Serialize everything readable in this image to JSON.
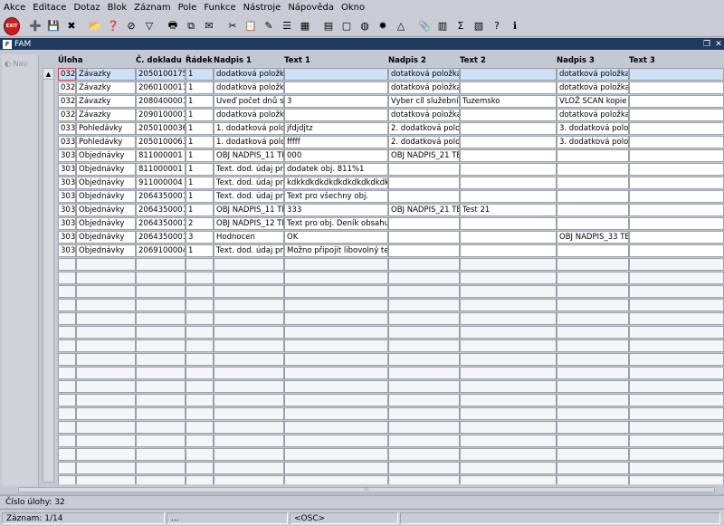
{
  "menu": [
    "Akce",
    "Editace",
    "Dotaz",
    "Blok",
    "Záznam",
    "Pole",
    "Funkce",
    "Nástroje",
    "Nápověda",
    "Okno"
  ],
  "toolbar": {
    "exit_label": "EXIT",
    "icons": [
      "add-record-icon",
      "save-icon",
      "delete-record-icon",
      "folder-open-icon",
      "query-icon",
      "clear-query-icon",
      "filter-icon",
      "print-icon",
      "copy-icon",
      "mail-icon",
      "cut-icon",
      "paste-icon",
      "edit-icon",
      "list-icon",
      "grid-icon",
      "calculator-icon",
      "document-icon",
      "globe-icon",
      "settings-icon",
      "triangle-icon",
      "attach-icon",
      "report-icon",
      "sum-icon",
      "chart-icon",
      "help-icon",
      "info-icon"
    ],
    "sum_glyph": "Σ"
  },
  "window": {
    "title": "FAM",
    "logo": "F"
  },
  "nav": {
    "label": "Nav"
  },
  "columns": [
    "Úloha",
    "Č. dokladu",
    "Řádek",
    "Nadpis 1",
    "Text 1",
    "Nadpis 2",
    "Text 2",
    "Nadpis 3",
    "Text 3"
  ],
  "rows": [
    [
      "032",
      "Závazky",
      "2050100175",
      "1",
      "dodatková položka",
      "",
      "dotatková položka č",
      "",
      "dotatková položka s",
      ""
    ],
    [
      "032",
      "Závazky",
      "2060100011",
      "1",
      "dodatková položka",
      "",
      "dotatková položka č",
      "",
      "dotatková položka s",
      ""
    ],
    [
      "032",
      "Závazky",
      "2080400001",
      "1",
      "Uveď počet dnů sl.",
      "3",
      "Vyber cíl služební c",
      "Tuzemsko",
      "VLOŽ SCAN kopie",
      ""
    ],
    [
      "032",
      "Závazky",
      "2090100001",
      "1",
      "dodatková položka",
      "",
      "dotatková položka č",
      "",
      "dotatková položka s",
      ""
    ],
    [
      "033",
      "Pohledávky",
      "2050100036",
      "1",
      "1. dodatková polož",
      "jfdjdjtz",
      "2. dodatková polož",
      "",
      "3. dodatková polož",
      ""
    ],
    [
      "033",
      "Pohledávky",
      "2050100063",
      "1",
      "1. dodatková polož",
      "fffff",
      "2. dodatková polož",
      "",
      "3. dodatková polož",
      ""
    ],
    [
      "303",
      "Objednávky",
      "811000001",
      "1",
      "OBJ NADPIS_11 TE",
      "000",
      "OBJ NADPIS_21 TE",
      "",
      "",
      ""
    ],
    [
      "303",
      "Objednávky",
      "811000001",
      "1",
      "Text. dod. údaj pro",
      "dodatek obj. 811%1",
      "",
      "",
      "",
      ""
    ],
    [
      "303",
      "Objednávky",
      "911000004",
      "1",
      "Text. dod. údaj pro",
      "kdkkdkdkdkdkdkdkdkdkdkd",
      "",
      "",
      "",
      ""
    ],
    [
      "303",
      "Objednávky",
      "2064350001",
      "1",
      "Text. dod. údaj pro",
      "Text pro všechny obj.",
      "",
      "",
      "",
      ""
    ],
    [
      "303",
      "Objednávky",
      "2064350001",
      "1",
      "OBJ NADPIS_11 TE",
      "333",
      "OBJ NADPIS_21 TE",
      "Test 21",
      "",
      ""
    ],
    [
      "303",
      "Objednávky",
      "2064350001",
      "2",
      "OBJ NADPIS_12 TE",
      "Text pro obj. Deník obsahuje",
      "",
      "",
      "",
      ""
    ],
    [
      "303",
      "Objednávky",
      "2064350001",
      "3",
      "Hodnocen",
      "OK",
      "",
      "",
      "OBJ NADPIS_33 TE",
      ""
    ],
    [
      "303",
      "Objednávky",
      "2069100004",
      "1",
      "Text. dod. údaj pro",
      "Možno připojit libovolný text n",
      "",
      "",
      "",
      ""
    ]
  ],
  "status": {
    "line1": "Číslo úlohy: 32",
    "record": "Záznam: 1/14",
    "field2": "...",
    "field3": "<OSC>"
  }
}
